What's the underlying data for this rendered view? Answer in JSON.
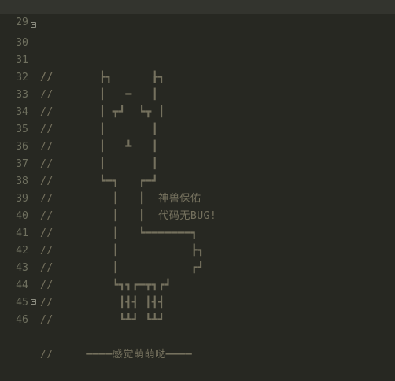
{
  "editor": {
    "lines": [
      {
        "no": "29",
        "text": ""
      },
      {
        "no": "30",
        "text": "//       ┏┓      ┏┓"
      },
      {
        "no": "31",
        "text": "//       ┃       ┃"
      },
      {
        "no": "32",
        "text": "//       ┃   ━   ┃"
      },
      {
        "no": "33",
        "text": "//       ┃ ┳┛  ┗┳ ┃"
      },
      {
        "no": "34",
        "text": "//       ┃       ┃"
      },
      {
        "no": "35",
        "text": "//       ┃   ┻   ┃"
      },
      {
        "no": "36",
        "text": "//       ┃       ┃"
      },
      {
        "no": "37",
        "text": "//       ┗━┓   ┏━┛"
      },
      {
        "no": "38",
        "text": "//         ┃   ┃  神兽保佑"
      },
      {
        "no": "39",
        "text": "//         ┃   ┃  代码无BUG!"
      },
      {
        "no": "40",
        "text": "//         ┃   ┗━━━━━━━┓"
      },
      {
        "no": "41",
        "text": "//         ┃           ┣┓"
      },
      {
        "no": "42",
        "text": "//         ┃           ┏┛"
      },
      {
        "no": "43",
        "text": "//         ┗┓┓┏━┳┓┏┛"
      },
      {
        "no": "44",
        "text": "//          ┃┫┫ ┃┫┫"
      },
      {
        "no": "45",
        "text": "//          ┗┻┛ ┗┻┛"
      },
      {
        "no": "46",
        "text": "//     ━━━━感觉萌萌哒━━━━"
      }
    ],
    "fold_markers": [
      "30",
      "46"
    ]
  }
}
